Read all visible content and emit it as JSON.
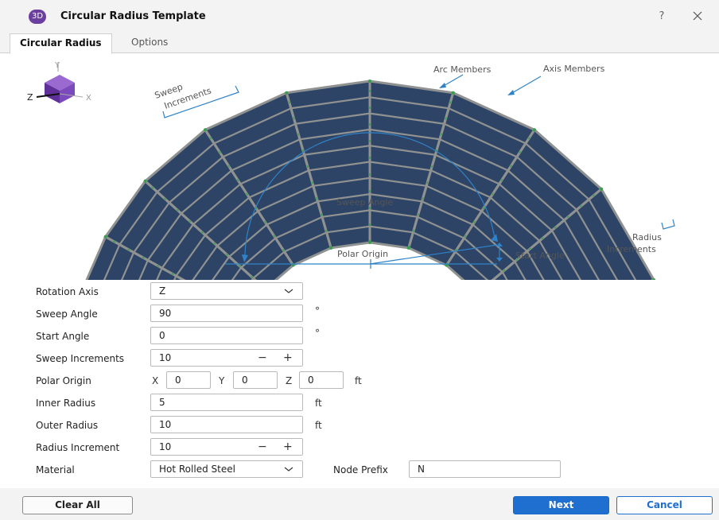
{
  "window": {
    "app_icon_text": "3D",
    "title": "Circular Radius Template",
    "help_label": "?"
  },
  "tabs": [
    {
      "label": "Circular Radius"
    },
    {
      "label": "Options"
    }
  ],
  "diagram": {
    "axis_labels": {
      "y": "Y",
      "z": "Z",
      "x": "X"
    },
    "annotations": {
      "sweep_increments": [
        "Sweep",
        "Increments"
      ],
      "arc_members": "Arc Members",
      "axis_members": "Axis Members",
      "sweep_angle": "Sweep Angle",
      "polar_origin": "Polar Origin",
      "start_angle": "Start Angle",
      "radius_increments": [
        "Radius",
        "Increments"
      ]
    },
    "colors": {
      "panel": "#2d4466",
      "member": "#8f9290",
      "node": "#35a04a",
      "annotation": "#2f82c8"
    }
  },
  "form": {
    "rotation_axis": {
      "label": "Rotation Axis",
      "value": "Z"
    },
    "sweep_angle": {
      "label": "Sweep Angle",
      "value": "90",
      "unit": "°"
    },
    "start_angle": {
      "label": "Start Angle",
      "value": "0",
      "unit": "°"
    },
    "sweep_increments": {
      "label": "Sweep Increments",
      "value": "10",
      "minus": "−",
      "plus": "+"
    },
    "polar_origin": {
      "label": "Polar Origin",
      "x_label": "X",
      "x": "0",
      "y_label": "Y",
      "y": "0",
      "z_label": "Z",
      "z": "0",
      "unit": "ft"
    },
    "inner_radius": {
      "label": "Inner Radius",
      "value": "5",
      "unit": "ft"
    },
    "outer_radius": {
      "label": "Outer Radius",
      "value": "10",
      "unit": "ft"
    },
    "radius_increment": {
      "label": "Radius Increment",
      "value": "10",
      "minus": "−",
      "plus": "+"
    },
    "material": {
      "label": "Material",
      "value": "Hot Rolled Steel"
    },
    "node_prefix": {
      "label": "Node Prefix",
      "value": "N"
    }
  },
  "buttons": {
    "clear_all": "Clear All",
    "next": "Next",
    "cancel": "Cancel"
  }
}
